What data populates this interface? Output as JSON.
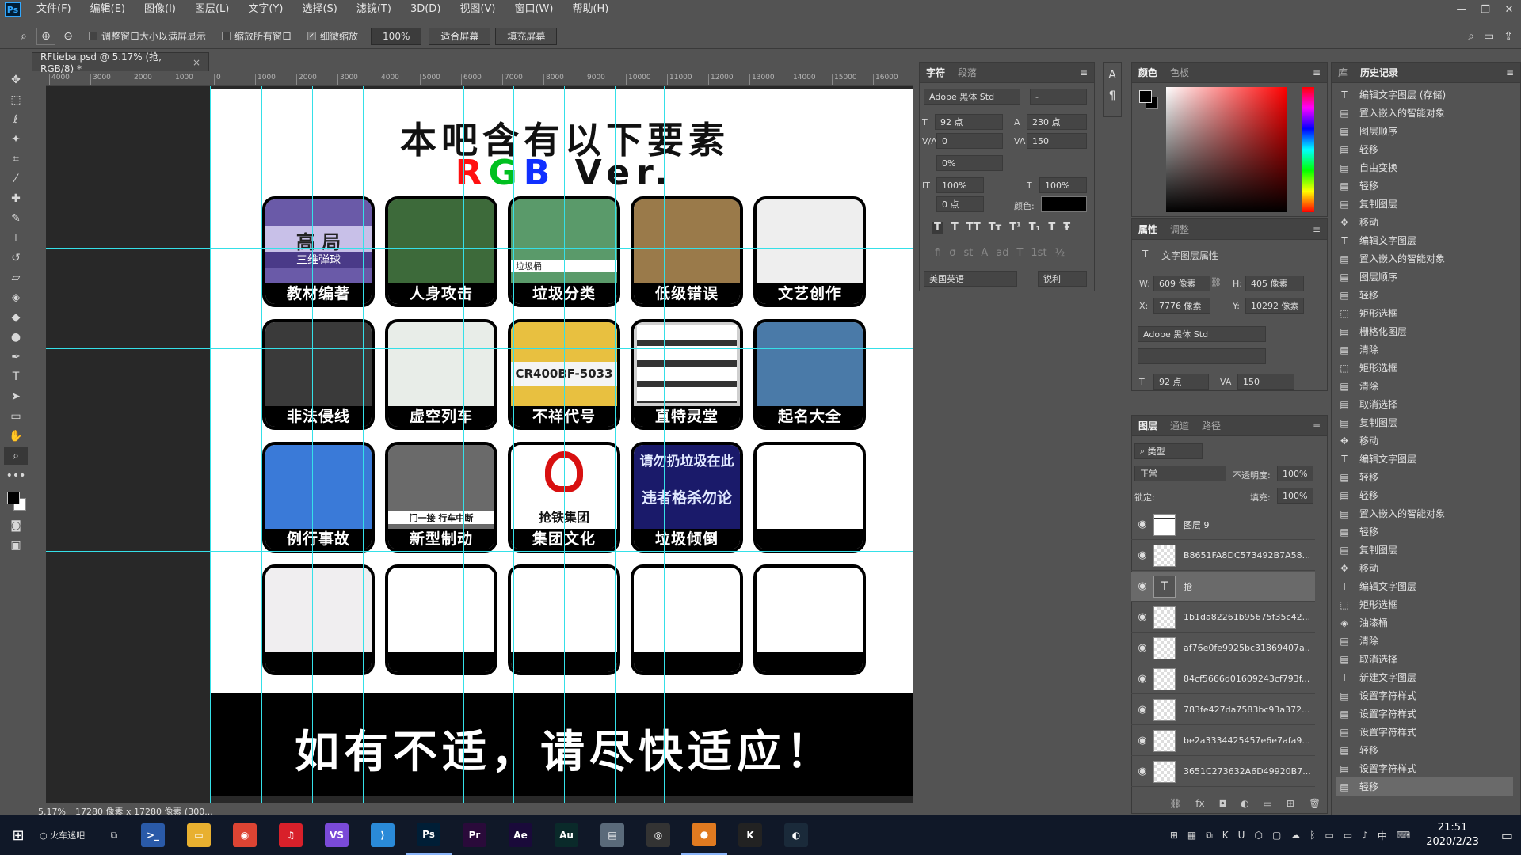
{
  "app": {
    "logo": "Ps"
  },
  "menu": [
    "文件(F)",
    "编辑(E)",
    "图像(I)",
    "图层(L)",
    "文字(Y)",
    "选择(S)",
    "滤镜(T)",
    "3D(D)",
    "视图(V)",
    "窗口(W)",
    "帮助(H)"
  ],
  "options": {
    "resize_windows": "调整窗口大小以满屏显示",
    "zoom_all": "缩放所有窗口",
    "scrubby_zoom": "细微缩放",
    "zoom_value": "100%",
    "fit_screen": "适合屏幕",
    "fill_screen": "填充屏幕"
  },
  "document": {
    "tab_title": "RFtieba.psd @ 5.17% (抢, RGB/8) *",
    "ruler_labels": [
      "4000",
      "3000",
      "2000",
      "1000",
      "0",
      "1000",
      "2000",
      "3000",
      "4000",
      "5000",
      "6000",
      "7000",
      "8000",
      "9000",
      "10000",
      "11000",
      "12000",
      "13000",
      "14000",
      "15000",
      "16000",
      "17"
    ],
    "status_zoom": "5.17%",
    "status_info": "17280 像素 x 17280 像素 (300..."
  },
  "artwork": {
    "title": "本吧含有以下要素",
    "subtitle_r": "R",
    "subtitle_g": "G",
    "subtitle_b": "B",
    "subtitle_rest": " Ver.",
    "footer": "如有不适，请尽快适应！",
    "cards": [
      {
        "label": "教材编著",
        "color": "#6a5aa8"
      },
      {
        "label": "人身攻击",
        "color": "#3d6a3a"
      },
      {
        "label": "垃圾分类",
        "color": "#5a9a6a"
      },
      {
        "label": "低级错误",
        "color": "#9a7a4a"
      },
      {
        "label": "文艺创作",
        "color": "#eeeeee"
      },
      {
        "label": "非法侵线",
        "color": "#3a3a3a"
      },
      {
        "label": "虚空列车",
        "color": "#e8ede8"
      },
      {
        "label": "不祥代号",
        "color": "#e8c040"
      },
      {
        "label": "直特灵堂",
        "color": "#cfcfcf"
      },
      {
        "label": "起名大全",
        "color": "#4a7aa8"
      },
      {
        "label": "例行事故",
        "color": "#3a7ad8"
      },
      {
        "label": "新型制动",
        "color": "#6a6a6a"
      },
      {
        "label": "集团文化",
        "color": "#ffffff"
      },
      {
        "label": "垃圾倾倒",
        "color": "#1a1a6a"
      },
      {
        "label": "",
        "color": "#ffffff"
      },
      {
        "label": "",
        "color": "#f0eef0"
      },
      {
        "label": "",
        "color": "#ffffff"
      },
      {
        "label": "",
        "color": "#ffffff"
      },
      {
        "label": "",
        "color": "#ffffff"
      },
      {
        "label": "",
        "color": "#ffffff"
      }
    ],
    "card_texts": {
      "c1_big": "高 局",
      "c1_small": "三维弹球",
      "c3_caption": "垃圾桶",
      "c8_code": "CR400BF-5033",
      "c13_text": "抢铁集团",
      "c14_line1": "请勿扔垃圾在此",
      "c14_line2": "违者格杀勿论",
      "c12_text": "门一接 行车中断"
    }
  },
  "character_panel": {
    "tabs": [
      "字符",
      "段落"
    ],
    "font_family": "Adobe 黑体 Std",
    "font_style": "-",
    "font_size": "92 点",
    "leading": "230 点",
    "kerning": "0",
    "tracking": "150",
    "scale_pct": "0%",
    "vscale": "100%",
    "hscale": "100%",
    "baseline": "0 点",
    "color_label": "颜色:",
    "language": "美国英语",
    "aa": "锐利"
  },
  "color_panel": {
    "tabs": [
      "颜色",
      "色板"
    ]
  },
  "library_tab": "库",
  "properties_panel": {
    "tabs": [
      "属性",
      "调整"
    ],
    "kind": "文字图层属性",
    "w": "609 像素",
    "h": "405 像素",
    "x": "7776 像素",
    "y": "10292 像素",
    "font": "Adobe 黑体 Std",
    "size": "92 点",
    "tracking": "150"
  },
  "layers_panel": {
    "tabs": [
      "图层",
      "通道",
      "路径"
    ],
    "filter": "类型",
    "blend": "正常",
    "opacity_label": "不透明度:",
    "opacity": "100%",
    "lock_label": "锁定:",
    "fill_label": "填充:",
    "fill": "100%",
    "layers": [
      {
        "name": "图层 9",
        "thumb": "grid",
        "sel": false
      },
      {
        "name": "B8651FA8DC573492B7A58...",
        "thumb": "smart",
        "sel": false
      },
      {
        "name": "抢",
        "thumb": "text",
        "sel": true
      },
      {
        "name": "1b1da82261b95675f35c42...",
        "thumb": "smart",
        "sel": false
      },
      {
        "name": "af76e0fe9925bc31869407a...",
        "thumb": "smart",
        "sel": false
      },
      {
        "name": "84cf5666d01609243cf793f...",
        "thumb": "smart",
        "sel": false
      },
      {
        "name": "783fe427da7583bc93a372...",
        "thumb": "smart",
        "sel": false
      },
      {
        "name": "be2a3334425457e6e7afa9...",
        "thumb": "smart",
        "sel": false
      },
      {
        "name": "3651C273632A6D49920B7...",
        "thumb": "smart",
        "sel": false
      }
    ]
  },
  "history_panel": {
    "tab": "历史记录",
    "items": [
      {
        "icon": "T",
        "label": "编辑文字图层 (存储)"
      },
      {
        "icon": "▤",
        "label": "置入嵌入的智能对象"
      },
      {
        "icon": "▤",
        "label": "图层顺序"
      },
      {
        "icon": "▤",
        "label": "轻移"
      },
      {
        "icon": "▤",
        "label": "自由变换"
      },
      {
        "icon": "▤",
        "label": "轻移"
      },
      {
        "icon": "▤",
        "label": "复制图层"
      },
      {
        "icon": "✥",
        "label": "移动"
      },
      {
        "icon": "T",
        "label": "编辑文字图层"
      },
      {
        "icon": "▤",
        "label": "置入嵌入的智能对象"
      },
      {
        "icon": "▤",
        "label": "图层顺序"
      },
      {
        "icon": "▤",
        "label": "轻移"
      },
      {
        "icon": "⬚",
        "label": "矩形选框"
      },
      {
        "icon": "▤",
        "label": "栅格化图层"
      },
      {
        "icon": "▤",
        "label": "清除"
      },
      {
        "icon": "⬚",
        "label": "矩形选框"
      },
      {
        "icon": "▤",
        "label": "清除"
      },
      {
        "icon": "▤",
        "label": "取消选择"
      },
      {
        "icon": "▤",
        "label": "复制图层"
      },
      {
        "icon": "✥",
        "label": "移动"
      },
      {
        "icon": "T",
        "label": "编辑文字图层"
      },
      {
        "icon": "▤",
        "label": "轻移"
      },
      {
        "icon": "▤",
        "label": "轻移"
      },
      {
        "icon": "▤",
        "label": "置入嵌入的智能对象"
      },
      {
        "icon": "▤",
        "label": "轻移"
      },
      {
        "icon": "▤",
        "label": "复制图层"
      },
      {
        "icon": "✥",
        "label": "移动"
      },
      {
        "icon": "T",
        "label": "编辑文字图层"
      },
      {
        "icon": "⬚",
        "label": "矩形选框"
      },
      {
        "icon": "◈",
        "label": "油漆桶"
      },
      {
        "icon": "▤",
        "label": "清除"
      },
      {
        "icon": "▤",
        "label": "取消选择"
      },
      {
        "icon": "T",
        "label": "新建文字图层"
      },
      {
        "icon": "▤",
        "label": "设置字符样式"
      },
      {
        "icon": "▤",
        "label": "设置字符样式"
      },
      {
        "icon": "▤",
        "label": "设置字符样式"
      },
      {
        "icon": "▤",
        "label": "轻移"
      },
      {
        "icon": "▤",
        "label": "设置字符样式"
      },
      {
        "icon": "▤",
        "label": "轻移"
      }
    ]
  },
  "taskbar": {
    "search_text": "火车迷吧",
    "apps": [
      {
        "name": "PowerShell",
        "glyph": ">_",
        "color": "#2a5aa8"
      },
      {
        "name": "Explorer",
        "glyph": "▭",
        "color": "#e8b030"
      },
      {
        "name": "Chrome",
        "glyph": "◉",
        "color": "#dd4433"
      },
      {
        "name": "NetEase Music",
        "glyph": "♫",
        "color": "#d8202a"
      },
      {
        "name": "Visual Studio",
        "glyph": "VS",
        "color": "#7a4ad8"
      },
      {
        "name": "VS Code",
        "glyph": "⟩",
        "color": "#2a8ad8"
      },
      {
        "name": "Photoshop",
        "glyph": "Ps",
        "color": "#001e36"
      },
      {
        "name": "Premiere",
        "glyph": "Pr",
        "color": "#2a0a3a"
      },
      {
        "name": "After Effects",
        "glyph": "Ae",
        "color": "#1a0a3a"
      },
      {
        "name": "Audition",
        "glyph": "Au",
        "color": "#0a2a2a"
      },
      {
        "name": "App",
        "glyph": "▤",
        "color": "#5a6a7a"
      },
      {
        "name": "Media",
        "glyph": "◎",
        "color": "#333"
      },
      {
        "name": "QQ",
        "glyph": "●",
        "color": "#e07a20"
      },
      {
        "name": "App K",
        "glyph": "K",
        "color": "#222"
      },
      {
        "name": "Steam",
        "glyph": "◐",
        "color": "#1a2a3a"
      }
    ],
    "time": "21:51",
    "date": "2020/2/23",
    "ime": "中"
  }
}
